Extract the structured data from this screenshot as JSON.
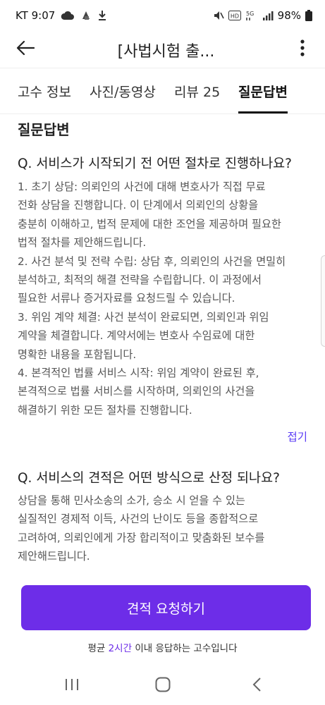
{
  "status_bar": {
    "carrier_time": "KT 9:07",
    "battery": "98%"
  },
  "app_bar": {
    "title": "[사법시험 출..."
  },
  "tabs": [
    {
      "label": "고수 정보"
    },
    {
      "label": "사진/동영상"
    },
    {
      "label": "리뷰 25"
    },
    {
      "label": "질문답변"
    }
  ],
  "section_title": "질문답변",
  "qa": [
    {
      "question": "Q. 서비스가 시작되기 전 어떤 절차로 진행하나요?",
      "answer": "1. 초기 상담: 의뢰인의 사건에 대해 변호사가 직접 무료\n전화 상담을 진행합니다. 이 단계에서 의뢰인의 상황을\n충분히 이해하고, 법적 문제에 대한 조언을 제공하며 필요한\n법적 절차를 제안해드립니다.\n2. 사건 분석 및 전략 수립: 상담 후, 의뢰인의 사건을 면밀히\n분석하고, 최적의 해결 전략을 수립합니다. 이 과정에서\n필요한 서류나 증거자료를 요청드릴 수 있습니다.\n3. 위임 계약 체결: 사건 분석이 완료되면, 의뢰인과 위임\n계약을 체결합니다. 계약서에는 변호사 수임료에 대한\n명확한 내용을 포함됩니다.\n4. 본격적인 법률 서비스 시작: 위임 계약이 완료된 후,\n본격적으로 법률 서비스를 시작하며, 의뢰인의 사건을\n해결하기 위한 모든 절차를 진행합니다.",
      "fold_label": "접기"
    },
    {
      "question": "Q. 서비스의 견적은 어떤 방식으로 산정 되나요?",
      "answer": "상담을 통해 민사소송의 소가, 승소 시 얻을 수 있는\n실질적인 경제적 이득, 사건의 난이도 등을 종합적으로\n고려하여, 의뢰인에게 가장 합리적이고 맞춤화된 보수를\n제안해드립니다."
    }
  ],
  "cta": {
    "button_label": "견적 요청하기",
    "note_prefix": "평균 ",
    "note_highlight": "2시간",
    "note_suffix": " 이내 응답하는 고수입니다"
  },
  "colors": {
    "accent": "#6d2de8",
    "link": "#5b3df5",
    "text_primary": "#222222",
    "text_secondary": "#555555"
  },
  "icons": {
    "back": "arrow-left-icon",
    "more": "more-vertical-icon",
    "nav_recents": "recents-icon",
    "nav_home": "home-icon",
    "nav_back": "chevron-left-icon"
  }
}
